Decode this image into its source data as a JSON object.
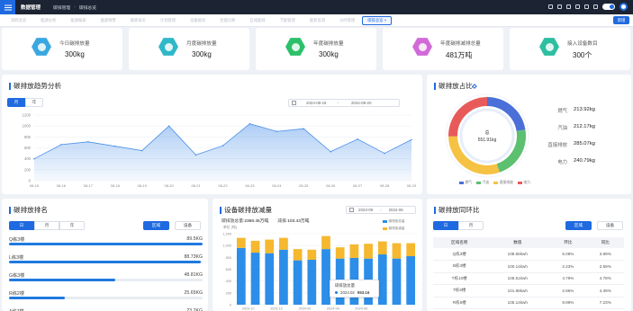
{
  "header": {
    "brand": "数据管理",
    "breadcrumb": [
      "碳排管理",
      "碳排总览"
    ],
    "icons": [
      "message-icon",
      "grid-icon",
      "settings-icon",
      "bell-icon",
      "mail-icon",
      "display-icon"
    ],
    "colors": {
      "topbar": "#1c2433",
      "accent": "#1f6ae0"
    }
  },
  "tabs": {
    "items": [
      "消耗总览",
      "能源分析",
      "能源报表",
      "能源预警",
      "能耗排名",
      "计划管理",
      "设备能效",
      "智能诊断",
      "区域能耗",
      "节能管理",
      "能耗监测",
      "分时管理",
      "碳排总览 ×"
    ],
    "active_index": 12,
    "new_button": "新增"
  },
  "stats": [
    {
      "label": "今日碳排放量",
      "value": "300kg",
      "color": "#3aa8e0",
      "icon": "molecule-icon"
    },
    {
      "label": "月度碳排放量",
      "value": "300kg",
      "color": "#2fb8c8",
      "icon": "molecule-icon"
    },
    {
      "label": "年度碳排放量",
      "value": "300kg",
      "color": "#2cc06a",
      "icon": "molecule-icon"
    },
    {
      "label": "年度碳排减排总量",
      "value": "481万吨",
      "color": "#d16ad8",
      "icon": "molecule-icon"
    },
    {
      "label": "接入设备数目",
      "value": "300个",
      "color": "#2cbfa0",
      "icon": "layers-icon"
    }
  ],
  "trend": {
    "title": "碳排放趋势分析",
    "segments": [
      "月",
      "年"
    ],
    "active_segment": 0,
    "date_start": "2024-08-15",
    "date_sep": "-",
    "date_end": "2024-08-20",
    "chart_data": {
      "type": "area",
      "x": [
        "08-15",
        "08-16",
        "08-17",
        "08-18",
        "08-19",
        "08-20",
        "08-21",
        "08-22",
        "08-23",
        "08-24",
        "08-25",
        "08-26",
        "08-27",
        "08-28",
        "08-29"
      ],
      "values": [
        400,
        660,
        710,
        630,
        550,
        1000,
        470,
        640,
        1040,
        900,
        950,
        530,
        760,
        500,
        750
      ],
      "y_ticks": [
        "1200",
        "1000",
        "800",
        "600",
        "400",
        "200",
        "0"
      ],
      "ylim": [
        0,
        1200
      ],
      "grid": true,
      "color": "#4a90e8"
    }
  },
  "proportion": {
    "title": "碳排放占比",
    "center_label": "总",
    "center_value": "551.91kg",
    "chart_data": {
      "type": "pie",
      "labels": [
        "燃气",
        "汽油",
        "直接排放",
        "电力"
      ],
      "values": [
        213.92,
        212.17,
        285.07,
        240.79
      ],
      "display_values": [
        "213.92kg",
        "212.17kg",
        "285.07kg",
        "240.79kg"
      ],
      "colors": [
        "#4a6fd8",
        "#5cc070",
        "#f5c243",
        "#e85a5a"
      ],
      "legend": [
        "燃气",
        "汽油",
        "直接排放",
        "电力"
      ]
    }
  },
  "ranking": {
    "title": "碳排放排名",
    "segments": [
      "日",
      "月",
      "年"
    ],
    "active_segment": 0,
    "btn_region": "区域",
    "btn_device": "设备",
    "items": [
      {
        "name": "Q栋3楼",
        "value": "89.5KG",
        "pct": 1.0
      },
      {
        "name": "L栋3楼",
        "value": "88.73KG",
        "pct": 0.99
      },
      {
        "name": "G栋3楼",
        "value": "48.81KG",
        "pct": 0.55
      },
      {
        "name": "R栋2楼",
        "value": "25.65KG",
        "pct": 0.29
      },
      {
        "name": "A栋7楼",
        "value": "23.2KG",
        "pct": 0.26
      }
    ]
  },
  "reduction": {
    "title": "设备碳排放减量",
    "date_start": "2023-09",
    "date_sep": "-",
    "date_end": "2024-06",
    "emission_label": "碳排放总量:",
    "emission_value": "2368.45万吨",
    "reduce_label": "减排:",
    "reduce_value": "103.43万吨",
    "unit": "单位 (吨)",
    "tooltip": {
      "title": "碳排放总量",
      "date": "2024.02",
      "value": "953.16"
    },
    "chart_data": {
      "type": "bar",
      "x_ticks": [
        "2023-10",
        "2023-12",
        "2024-02",
        "2024-04",
        "2024-06"
      ],
      "y_ticks": [
        "1,200",
        "1,000",
        "800",
        "600",
        "400",
        "200",
        "0"
      ],
      "ylim": [
        0,
        1200
      ],
      "series": [
        {
          "name": "碳排放总量",
          "color": "#2c8ee8",
          "values": [
            960,
            880,
            870,
            930,
            750,
            760,
            940,
            780,
            790,
            780,
            850,
            780,
            820
          ]
        },
        {
          "name": "碳排放减量",
          "color": "#f5b82e",
          "values": [
            170,
            200,
            230,
            200,
            190,
            170,
            220,
            190,
            230,
            250,
            220,
            260,
            220
          ]
        }
      ]
    }
  },
  "comparison": {
    "title": "碳排放同环比",
    "segments": [
      "日",
      "月"
    ],
    "active_segment": 0,
    "btn_region": "区域",
    "btn_device": "设备",
    "columns": [
      "区域名称",
      "数值",
      "环比",
      "同比"
    ],
    "rows": [
      [
        "Q栋3楼",
        "108.55kwh",
        "5.08%",
        "3.89%"
      ],
      [
        "B栋3楼",
        "100.14kwh",
        "2.23%",
        "2.59%"
      ],
      [
        "T栋10楼",
        "105.51kwh",
        "4.79%",
        "4.78%"
      ],
      [
        "T栋6楼",
        "101.98kwh",
        "2.96%",
        "4.39%"
      ],
      [
        "R栋5楼",
        "105.14kwh",
        "9.99%",
        "7.23%"
      ]
    ]
  }
}
